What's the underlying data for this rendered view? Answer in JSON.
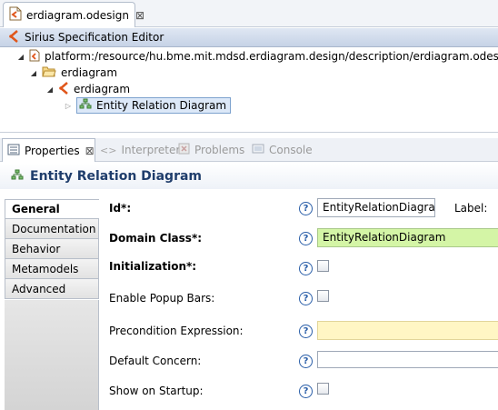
{
  "editor": {
    "tab_label": "erdiagram.odesign",
    "tab_close": "⊠",
    "header_title": "Sirius Specification Editor"
  },
  "tree": {
    "items": [
      {
        "label": "platform:/resource/hu.bme.mit.mdsd.erdiagram.design/description/erdiagram.odesign",
        "twisty": "◢"
      },
      {
        "label": "erdiagram",
        "twisty": "◢"
      },
      {
        "label": "erdiagram",
        "twisty": "◢"
      },
      {
        "label": "Entity Relation Diagram",
        "twisty": "▷"
      }
    ]
  },
  "views": {
    "tabs": [
      {
        "label": "Properties",
        "close": "⊠"
      },
      {
        "label": "Interpreter",
        "glyph": "<>"
      },
      {
        "label": "Problems"
      },
      {
        "label": "Console"
      }
    ]
  },
  "properties": {
    "title": "Entity Relation Diagram",
    "side_tabs": [
      "General",
      "Documentation",
      "Behavior",
      "Metamodels",
      "Advanced"
    ],
    "fields": {
      "id": {
        "label": "Id*:",
        "value": "EntityRelationDiagram",
        "extra_label": "Label:"
      },
      "domain_class": {
        "label": "Domain Class*:",
        "value": "EntityRelationDiagram"
      },
      "initialization": {
        "label": "Initialization*:"
      },
      "enable_popup_bars": {
        "label": "Enable Popup Bars:"
      },
      "precondition": {
        "label": "Precondition Expression:",
        "value": ""
      },
      "default_concern": {
        "label": "Default Concern:",
        "value": ""
      },
      "show_on_startup": {
        "label": "Show on Startup:"
      }
    },
    "help_glyph": "?"
  },
  "colors": {
    "domain_class_bg": "#d4f5a6",
    "precondition_bg": "#fff6c4",
    "selection_bg": "#dce8f8",
    "title_text": "#1f3d6b"
  }
}
